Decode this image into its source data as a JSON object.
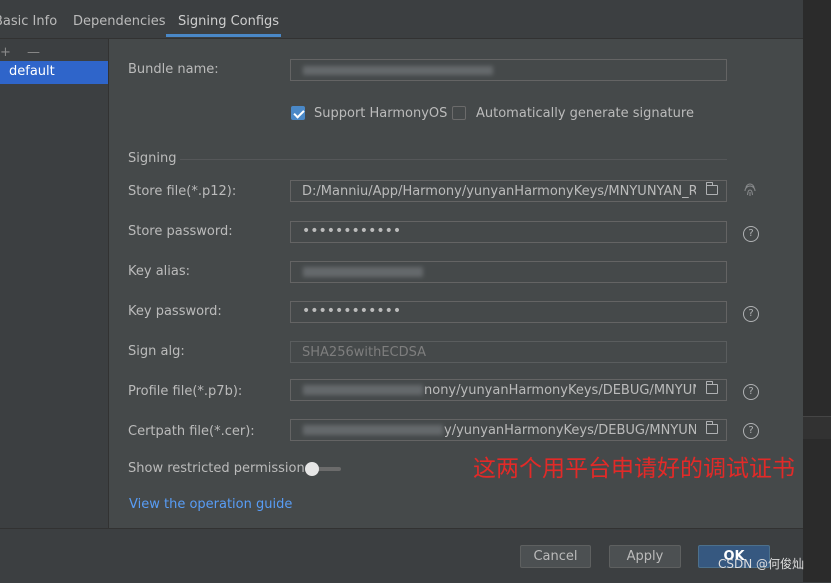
{
  "tabs": [
    {
      "label": "Basic Info"
    },
    {
      "label": "Dependencies"
    },
    {
      "label": "Signing Configs"
    }
  ],
  "sidebar": {
    "tools": "+ —",
    "items": [
      {
        "label": "default"
      }
    ]
  },
  "form": {
    "bundle_name_label": "Bundle name:",
    "support_harmonyos": {
      "label": "Support HarmonyOS",
      "checked": true
    },
    "auto_signature": {
      "label": "Automatically generate signature",
      "checked": false
    },
    "signing_section": "Signing",
    "store_file": {
      "label": "Store file(*.p12):",
      "value": "D:/Manniu/App/Harmony/yunyanHarmonyKeys/MNYUNYAN_Releas"
    },
    "store_password": {
      "label": "Store password:",
      "value": "••••••••••••"
    },
    "key_alias": {
      "label": "Key alias:"
    },
    "key_password": {
      "label": "Key password:",
      "value": "••••••••••••"
    },
    "sign_alg": {
      "label": "Sign alg:",
      "value": "SHA256withECDSA"
    },
    "profile_file": {
      "label": "Profile file(*.p7b):",
      "value": "nony/yunyanHarmonyKeys/DEBUG/MNYUNYAN"
    },
    "certpath_file": {
      "label": "Certpath file(*.cer):",
      "value": "y/yunyanHarmonyKeys/DEBUG/MNYUNYAN"
    },
    "show_restricted": {
      "label": "Show restricted permissions",
      "enabled": false
    },
    "operation_guide": "View the operation guide"
  },
  "annotation": "这两个用平台申请好的调试证书",
  "footer": {
    "cancel": "Cancel",
    "apply": "Apply",
    "ok": "OK"
  },
  "watermark": "CSDN @何俊灿",
  "icons": {
    "folder": "folder-icon",
    "help": "help-icon",
    "fingerprint": "fingerprint-icon"
  },
  "colors": {
    "accent": "#4a88c7",
    "selection": "#2f65ca",
    "link": "#589df6",
    "annotation": "#e22a28"
  }
}
